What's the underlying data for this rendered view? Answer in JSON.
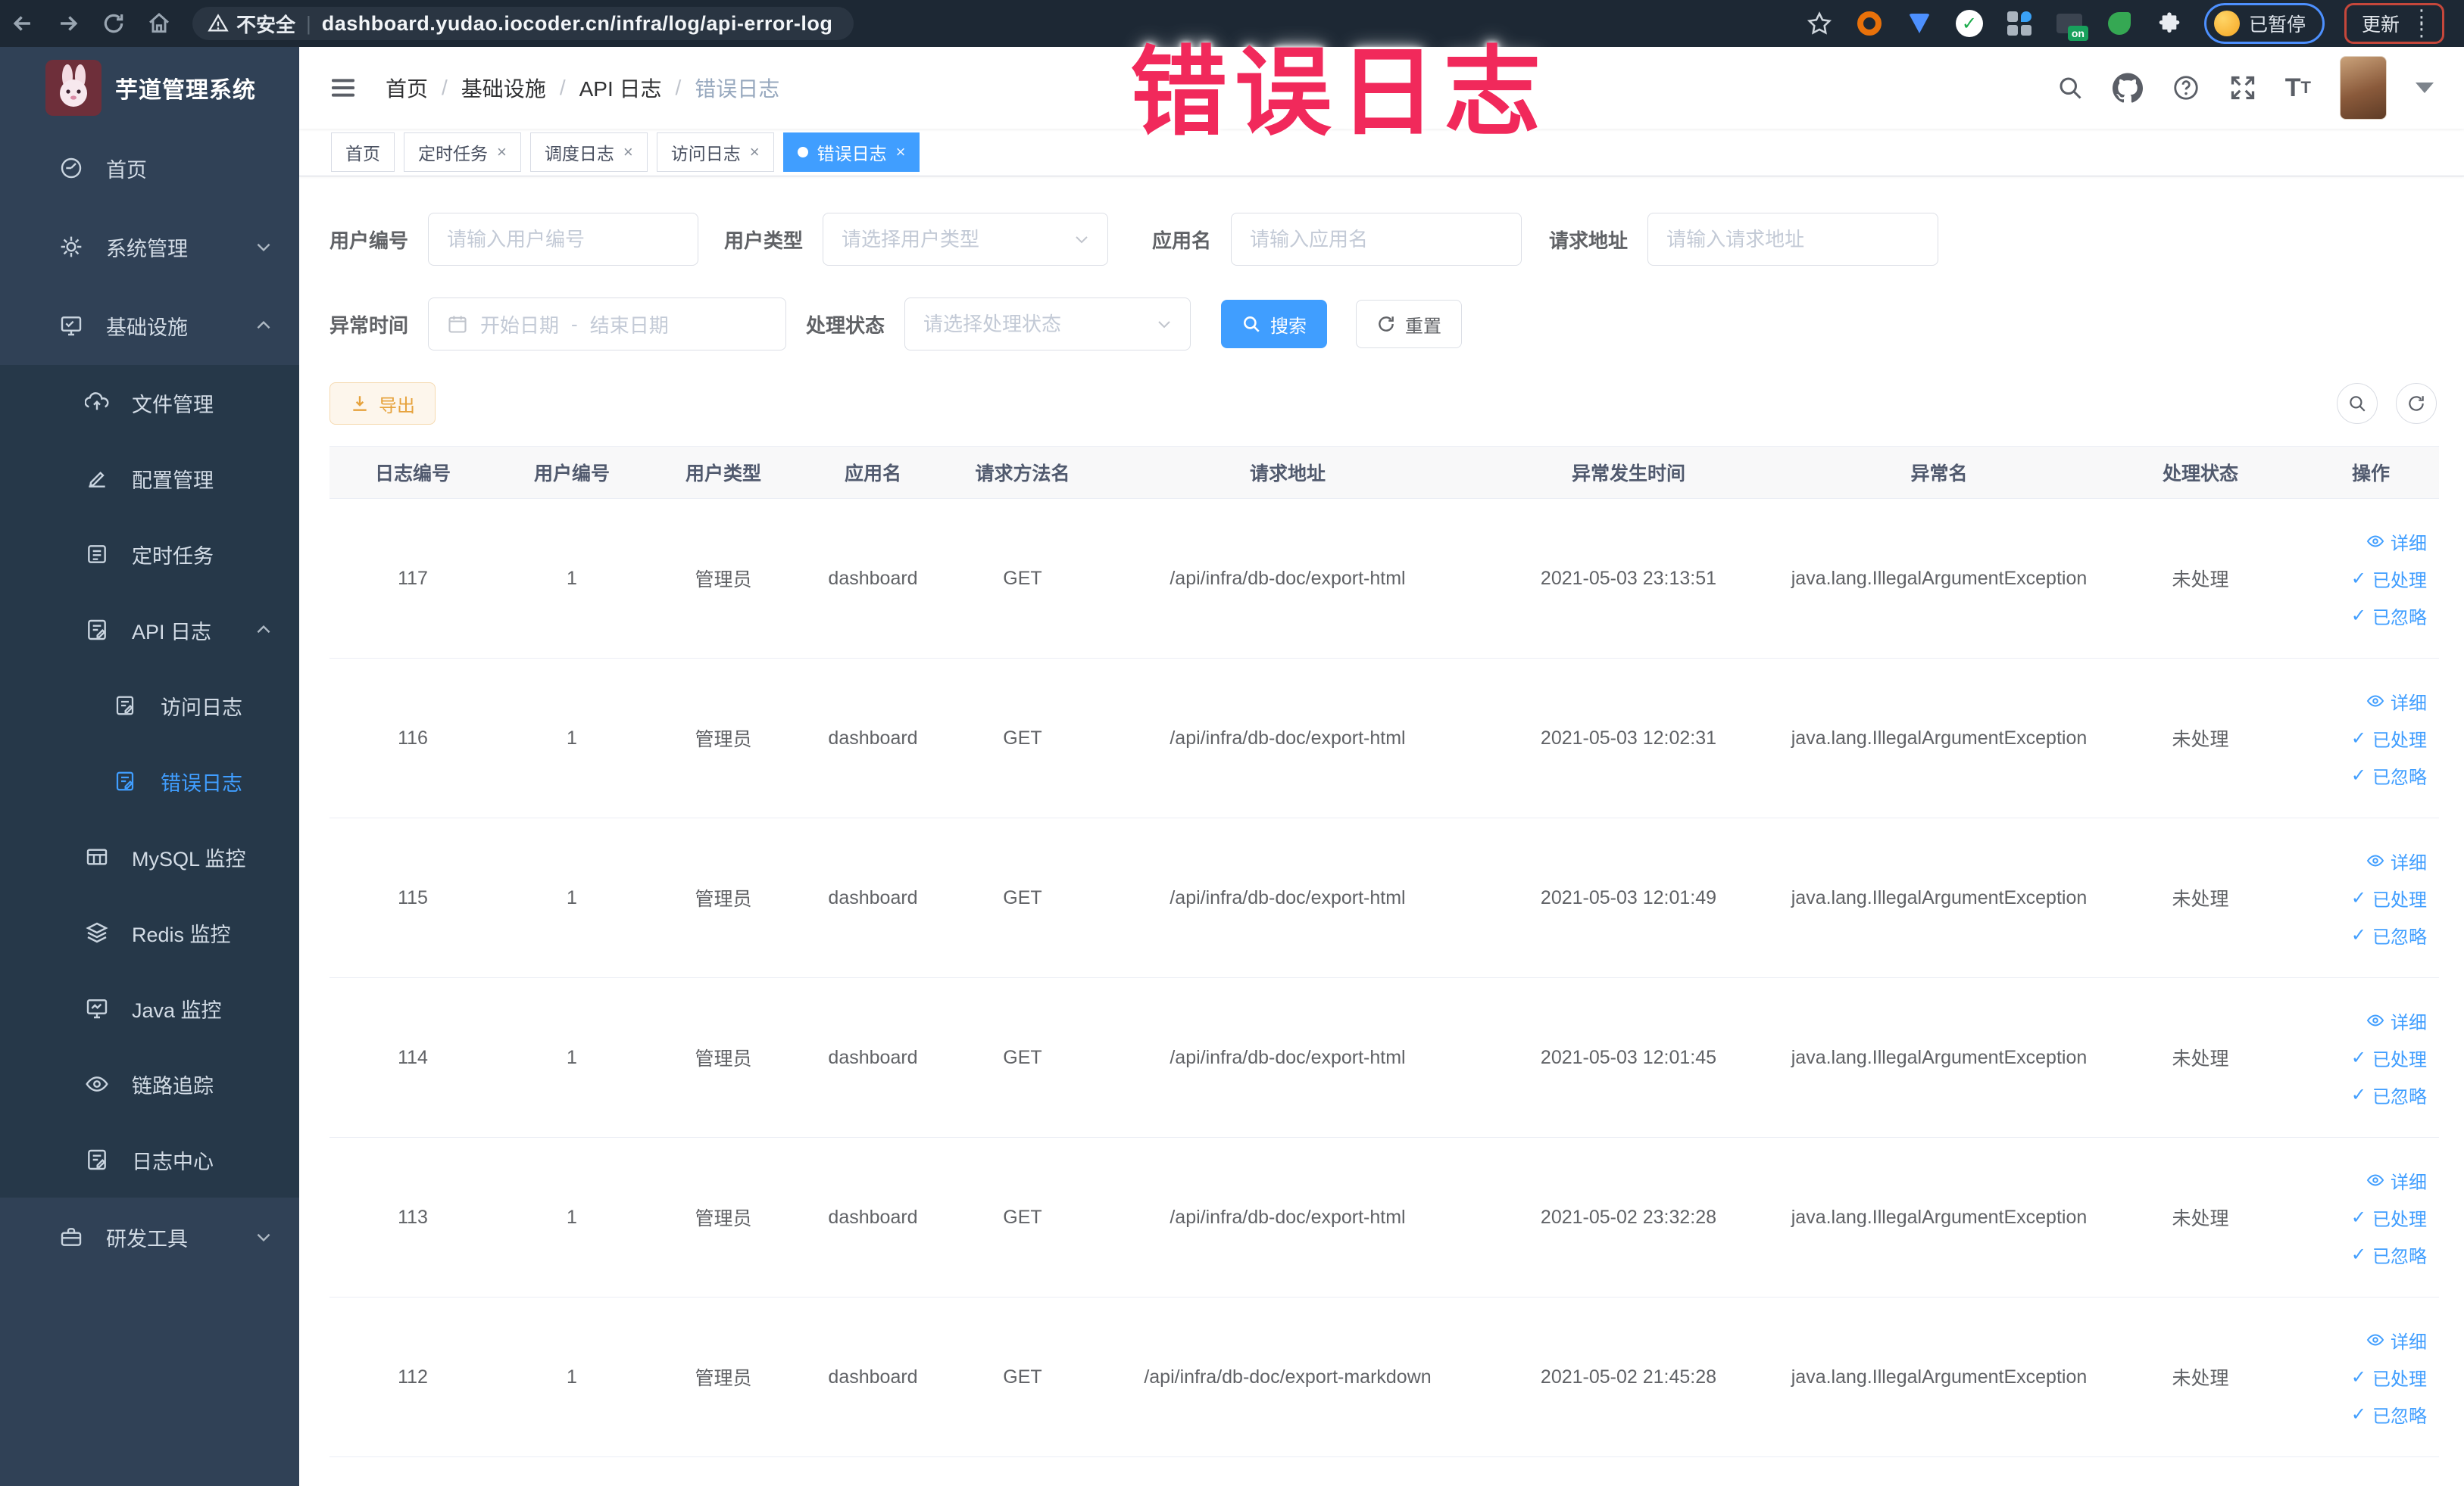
{
  "browser": {
    "security_label": "不安全",
    "url": "dashboard.yudao.iocoder.cn/infra/log/api-error-log",
    "on_badge": "on",
    "paused_label": "已暂停",
    "update_label": "更新"
  },
  "annotation": {
    "text": "错误日志",
    "color": "#f1295b"
  },
  "sidebar": {
    "logo_title": "芋道管理系统",
    "items": [
      {
        "label": "首页",
        "icon": "dashboard-icon"
      },
      {
        "label": "系统管理",
        "icon": "gear-icon",
        "expand": "down"
      },
      {
        "label": "基础设施",
        "icon": "monitor-icon",
        "expand": "up",
        "children": [
          {
            "label": "文件管理",
            "icon": "upload-icon"
          },
          {
            "label": "配置管理",
            "icon": "edit-icon"
          },
          {
            "label": "定时任务",
            "icon": "task-icon"
          },
          {
            "label": "API 日志",
            "icon": "log-icon",
            "expand": "up",
            "children": [
              {
                "label": "访问日志",
                "icon": "log-icon"
              },
              {
                "label": "错误日志",
                "icon": "log-icon",
                "active": true
              }
            ]
          },
          {
            "label": "MySQL 监控",
            "icon": "table-icon"
          },
          {
            "label": "Redis 监控",
            "icon": "layers-icon"
          },
          {
            "label": "Java 监控",
            "icon": "screen-icon"
          },
          {
            "label": "链路追踪",
            "icon": "eye-icon"
          },
          {
            "label": "日志中心",
            "icon": "log-icon"
          }
        ]
      },
      {
        "label": "研发工具",
        "icon": "toolbox-icon",
        "expand": "down"
      }
    ]
  },
  "header": {
    "breadcrumb": [
      "首页",
      "基础设施",
      "API 日志",
      "错误日志"
    ]
  },
  "tabs": [
    {
      "label": "首页",
      "closable": false,
      "active": false
    },
    {
      "label": "定时任务",
      "closable": true,
      "active": false
    },
    {
      "label": "调度日志",
      "closable": true,
      "active": false
    },
    {
      "label": "访问日志",
      "closable": true,
      "active": false
    },
    {
      "label": "错误日志",
      "closable": true,
      "active": true
    }
  ],
  "filters": {
    "user_id": {
      "label": "用户编号",
      "placeholder": "请输入用户编号",
      "value": ""
    },
    "user_type": {
      "label": "用户类型",
      "placeholder": "请选择用户类型",
      "value": ""
    },
    "app_name": {
      "label": "应用名",
      "placeholder": "请输入应用名",
      "value": ""
    },
    "request_url": {
      "label": "请求地址",
      "placeholder": "请输入请求地址",
      "value": ""
    },
    "exception_time": {
      "label": "异常时间",
      "start_placeholder": "开始日期",
      "separator": "-",
      "end_placeholder": "结束日期",
      "value": ""
    },
    "process_status": {
      "label": "处理状态",
      "placeholder": "请选择处理状态",
      "value": ""
    },
    "search_label": "搜索",
    "reset_label": "重置",
    "export_label": "导出"
  },
  "table": {
    "columns": [
      "日志编号",
      "用户编号",
      "用户类型",
      "应用名",
      "请求方法名",
      "请求地址",
      "异常发生时间",
      "异常名",
      "处理状态",
      "操作"
    ],
    "rows": [
      {
        "id": "117",
        "user_id": "1",
        "user_type": "管理员",
        "app": "dashboard",
        "method": "GET",
        "url": "/api/infra/db-doc/export-html",
        "time": "2021-05-03 23:13:51",
        "exception": "java.lang.IllegalArgumentException",
        "status": "未处理"
      },
      {
        "id": "116",
        "user_id": "1",
        "user_type": "管理员",
        "app": "dashboard",
        "method": "GET",
        "url": "/api/infra/db-doc/export-html",
        "time": "2021-05-03 12:02:31",
        "exception": "java.lang.IllegalArgumentException",
        "status": "未处理"
      },
      {
        "id": "115",
        "user_id": "1",
        "user_type": "管理员",
        "app": "dashboard",
        "method": "GET",
        "url": "/api/infra/db-doc/export-html",
        "time": "2021-05-03 12:01:49",
        "exception": "java.lang.IllegalArgumentException",
        "status": "未处理"
      },
      {
        "id": "114",
        "user_id": "1",
        "user_type": "管理员",
        "app": "dashboard",
        "method": "GET",
        "url": "/api/infra/db-doc/export-html",
        "time": "2021-05-03 12:01:45",
        "exception": "java.lang.IllegalArgumentException",
        "status": "未处理"
      },
      {
        "id": "113",
        "user_id": "1",
        "user_type": "管理员",
        "app": "dashboard",
        "method": "GET",
        "url": "/api/infra/db-doc/export-html",
        "time": "2021-05-02 23:32:28",
        "exception": "java.lang.IllegalArgumentException",
        "status": "未处理"
      },
      {
        "id": "112",
        "user_id": "1",
        "user_type": "管理员",
        "app": "dashboard",
        "method": "GET",
        "url": "/api/infra/db-doc/export-markdown",
        "time": "2021-05-02 21:45:28",
        "exception": "java.lang.IllegalArgumentException",
        "status": "未处理"
      }
    ]
  },
  "row_actions": {
    "detail": "详细",
    "processed": "已处理",
    "ignored": "已忽略"
  },
  "colors": {
    "accent": "#409eff",
    "warn": "#e6a23c",
    "annotation": "#f1295b",
    "sidebar_bg": "#304156",
    "submenu_bg": "#263849"
  }
}
